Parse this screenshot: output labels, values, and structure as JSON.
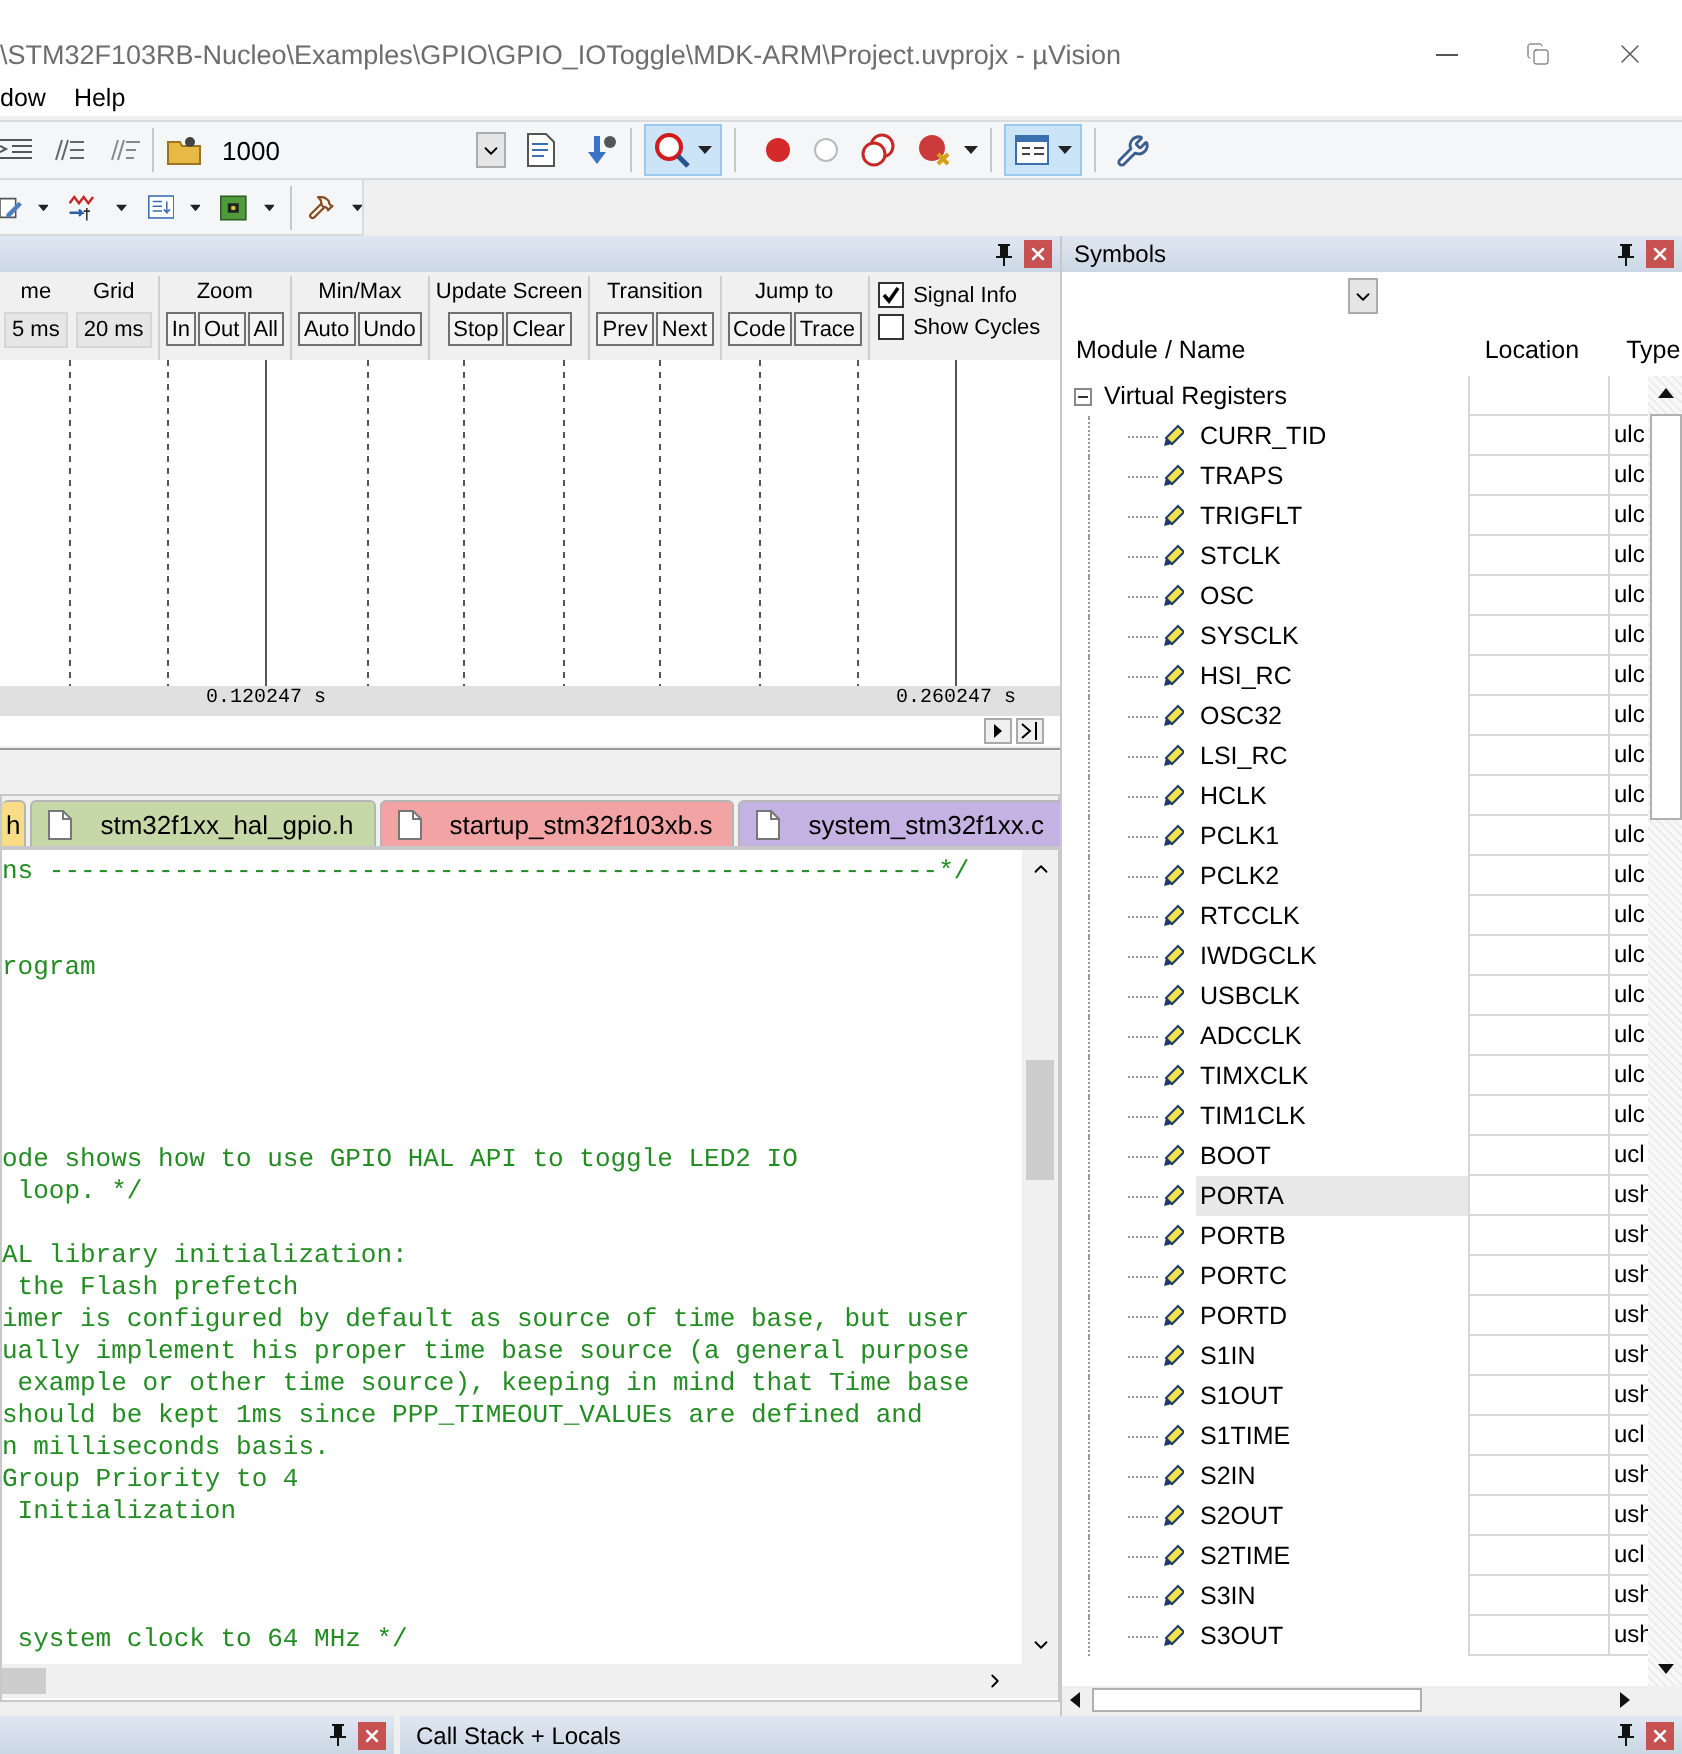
{
  "window": {
    "title": "\\STM32F103RB-Nucleo\\Examples\\GPIO\\GPIO_IOToggle\\MDK-ARM\\Project.uvprojx - µVision"
  },
  "menu": [
    "dow",
    "Help"
  ],
  "toolbar": {
    "value": "1000",
    "debug_active": true,
    "window_active": true
  },
  "logic_analyzer": {
    "settings": [
      {
        "label": "me",
        "value": "5 ms"
      },
      {
        "label": "Grid",
        "value": "20 ms"
      }
    ],
    "groups": [
      {
        "label": "Zoom",
        "buttons": [
          "In",
          "Out",
          "All"
        ]
      },
      {
        "label": "Min/Max",
        "buttons": [
          "Auto",
          "Undo"
        ]
      },
      {
        "label": "Update Screen",
        "buttons": [
          "Stop",
          "Clear"
        ]
      },
      {
        "label": "Transition",
        "buttons": [
          "Prev",
          "Next"
        ]
      },
      {
        "label": "Jump to",
        "buttons": [
          "Code",
          "Trace"
        ]
      }
    ],
    "checkboxes": [
      {
        "label": "Signal Info",
        "checked": true
      },
      {
        "label": "Show Cycles",
        "checked": false
      }
    ],
    "time_labels": [
      "0.120247 s",
      "0.260247 s"
    ]
  },
  "editor": {
    "tabs": [
      {
        "label": "h",
        "color": "#f9dc86"
      },
      {
        "label": "stm32f1xx_hal_gpio.h",
        "color": "#c6d7a8"
      },
      {
        "label": "startup_stm32f103xb.s",
        "color": "#f2a4a4"
      },
      {
        "label": "system_stm32f1xx.c",
        "color": "#c4b2e2"
      }
    ],
    "lines": [
      {
        "kind": "comment",
        "text": "ns ---------------------------------------------------------*/"
      },
      {
        "kind": "blank"
      },
      {
        "kind": "blank"
      },
      {
        "kind": "comment",
        "text": "rogram"
      },
      {
        "kind": "blank"
      },
      {
        "kind": "blank"
      },
      {
        "kind": "blank"
      },
      {
        "kind": "blank"
      },
      {
        "kind": "blank"
      },
      {
        "kind": "comment",
        "text": "ode shows how to use GPIO HAL API to toggle LED2 IO"
      },
      {
        "kind": "comment",
        "text": " loop. */"
      },
      {
        "kind": "blank"
      },
      {
        "kind": "comment",
        "text": "AL library initialization:"
      },
      {
        "kind": "comment",
        "text": " the Flash prefetch"
      },
      {
        "kind": "comment",
        "text": "imer is configured by default as source of time base, but user"
      },
      {
        "kind": "comment",
        "text": "ually implement his proper time base source (a general purpose"
      },
      {
        "kind": "comment",
        "text": " example or other time source), keeping in mind that Time base"
      },
      {
        "kind": "comment",
        "text": "should be kept 1ms since PPP_TIMEOUT_VALUEs are defined and"
      },
      {
        "kind": "comment",
        "text": "n milliseconds basis."
      },
      {
        "kind": "comment",
        "text": "Group Priority to 4"
      },
      {
        "kind": "comment",
        "text": " Initialization"
      },
      {
        "kind": "blank"
      },
      {
        "kind": "blank"
      },
      {
        "kind": "blank"
      },
      {
        "kind": "comment",
        "text": " system clock to 64 MHz */"
      }
    ]
  },
  "symbols": {
    "title": "Symbols",
    "columns": [
      "Module / Name",
      "Location",
      "Type"
    ],
    "tree": {
      "name": "Virtual Registers",
      "expanded": true,
      "children": [
        {
          "name": "CURR_TID",
          "type": "ulc",
          "selected": false
        },
        {
          "name": "TRAPS",
          "type": "ulc",
          "selected": false
        },
        {
          "name": "TRIGFLT",
          "type": "ulc",
          "selected": false
        },
        {
          "name": "STCLK",
          "type": "ulc",
          "selected": false
        },
        {
          "name": "OSC",
          "type": "ulc",
          "selected": false
        },
        {
          "name": "SYSCLK",
          "type": "ulc",
          "selected": false
        },
        {
          "name": "HSI_RC",
          "type": "ulc",
          "selected": false
        },
        {
          "name": "OSC32",
          "type": "ulc",
          "selected": false
        },
        {
          "name": "LSI_RC",
          "type": "ulc",
          "selected": false
        },
        {
          "name": "HCLK",
          "type": "ulc",
          "selected": false
        },
        {
          "name": "PCLK1",
          "type": "ulc",
          "selected": false
        },
        {
          "name": "PCLK2",
          "type": "ulc",
          "selected": false
        },
        {
          "name": "RTCCLK",
          "type": "ulc",
          "selected": false
        },
        {
          "name": "IWDGCLK",
          "type": "ulc",
          "selected": false
        },
        {
          "name": "USBCLK",
          "type": "ulc",
          "selected": false
        },
        {
          "name": "ADCCLK",
          "type": "ulc",
          "selected": false
        },
        {
          "name": "TIMXCLK",
          "type": "ulc",
          "selected": false
        },
        {
          "name": "TIM1CLK",
          "type": "ulc",
          "selected": false
        },
        {
          "name": "BOOT",
          "type": "ucl",
          "selected": false
        },
        {
          "name": "PORTA",
          "type": "ush",
          "selected": true
        },
        {
          "name": "PORTB",
          "type": "ush",
          "selected": false
        },
        {
          "name": "PORTC",
          "type": "ush",
          "selected": false
        },
        {
          "name": "PORTD",
          "type": "ush",
          "selected": false
        },
        {
          "name": "S1IN",
          "type": "ush",
          "selected": false
        },
        {
          "name": "S1OUT",
          "type": "ush",
          "selected": false
        },
        {
          "name": "S1TIME",
          "type": "ucl",
          "selected": false
        },
        {
          "name": "S2IN",
          "type": "ush",
          "selected": false
        },
        {
          "name": "S2OUT",
          "type": "ush",
          "selected": false
        },
        {
          "name": "S2TIME",
          "type": "ucl",
          "selected": false
        },
        {
          "name": "S3IN",
          "type": "ush",
          "selected": false
        },
        {
          "name": "S3OUT",
          "type": "ush",
          "selected": false
        }
      ]
    }
  },
  "bottom_bar": {
    "call_stack_title": "Call Stack + Locals"
  }
}
